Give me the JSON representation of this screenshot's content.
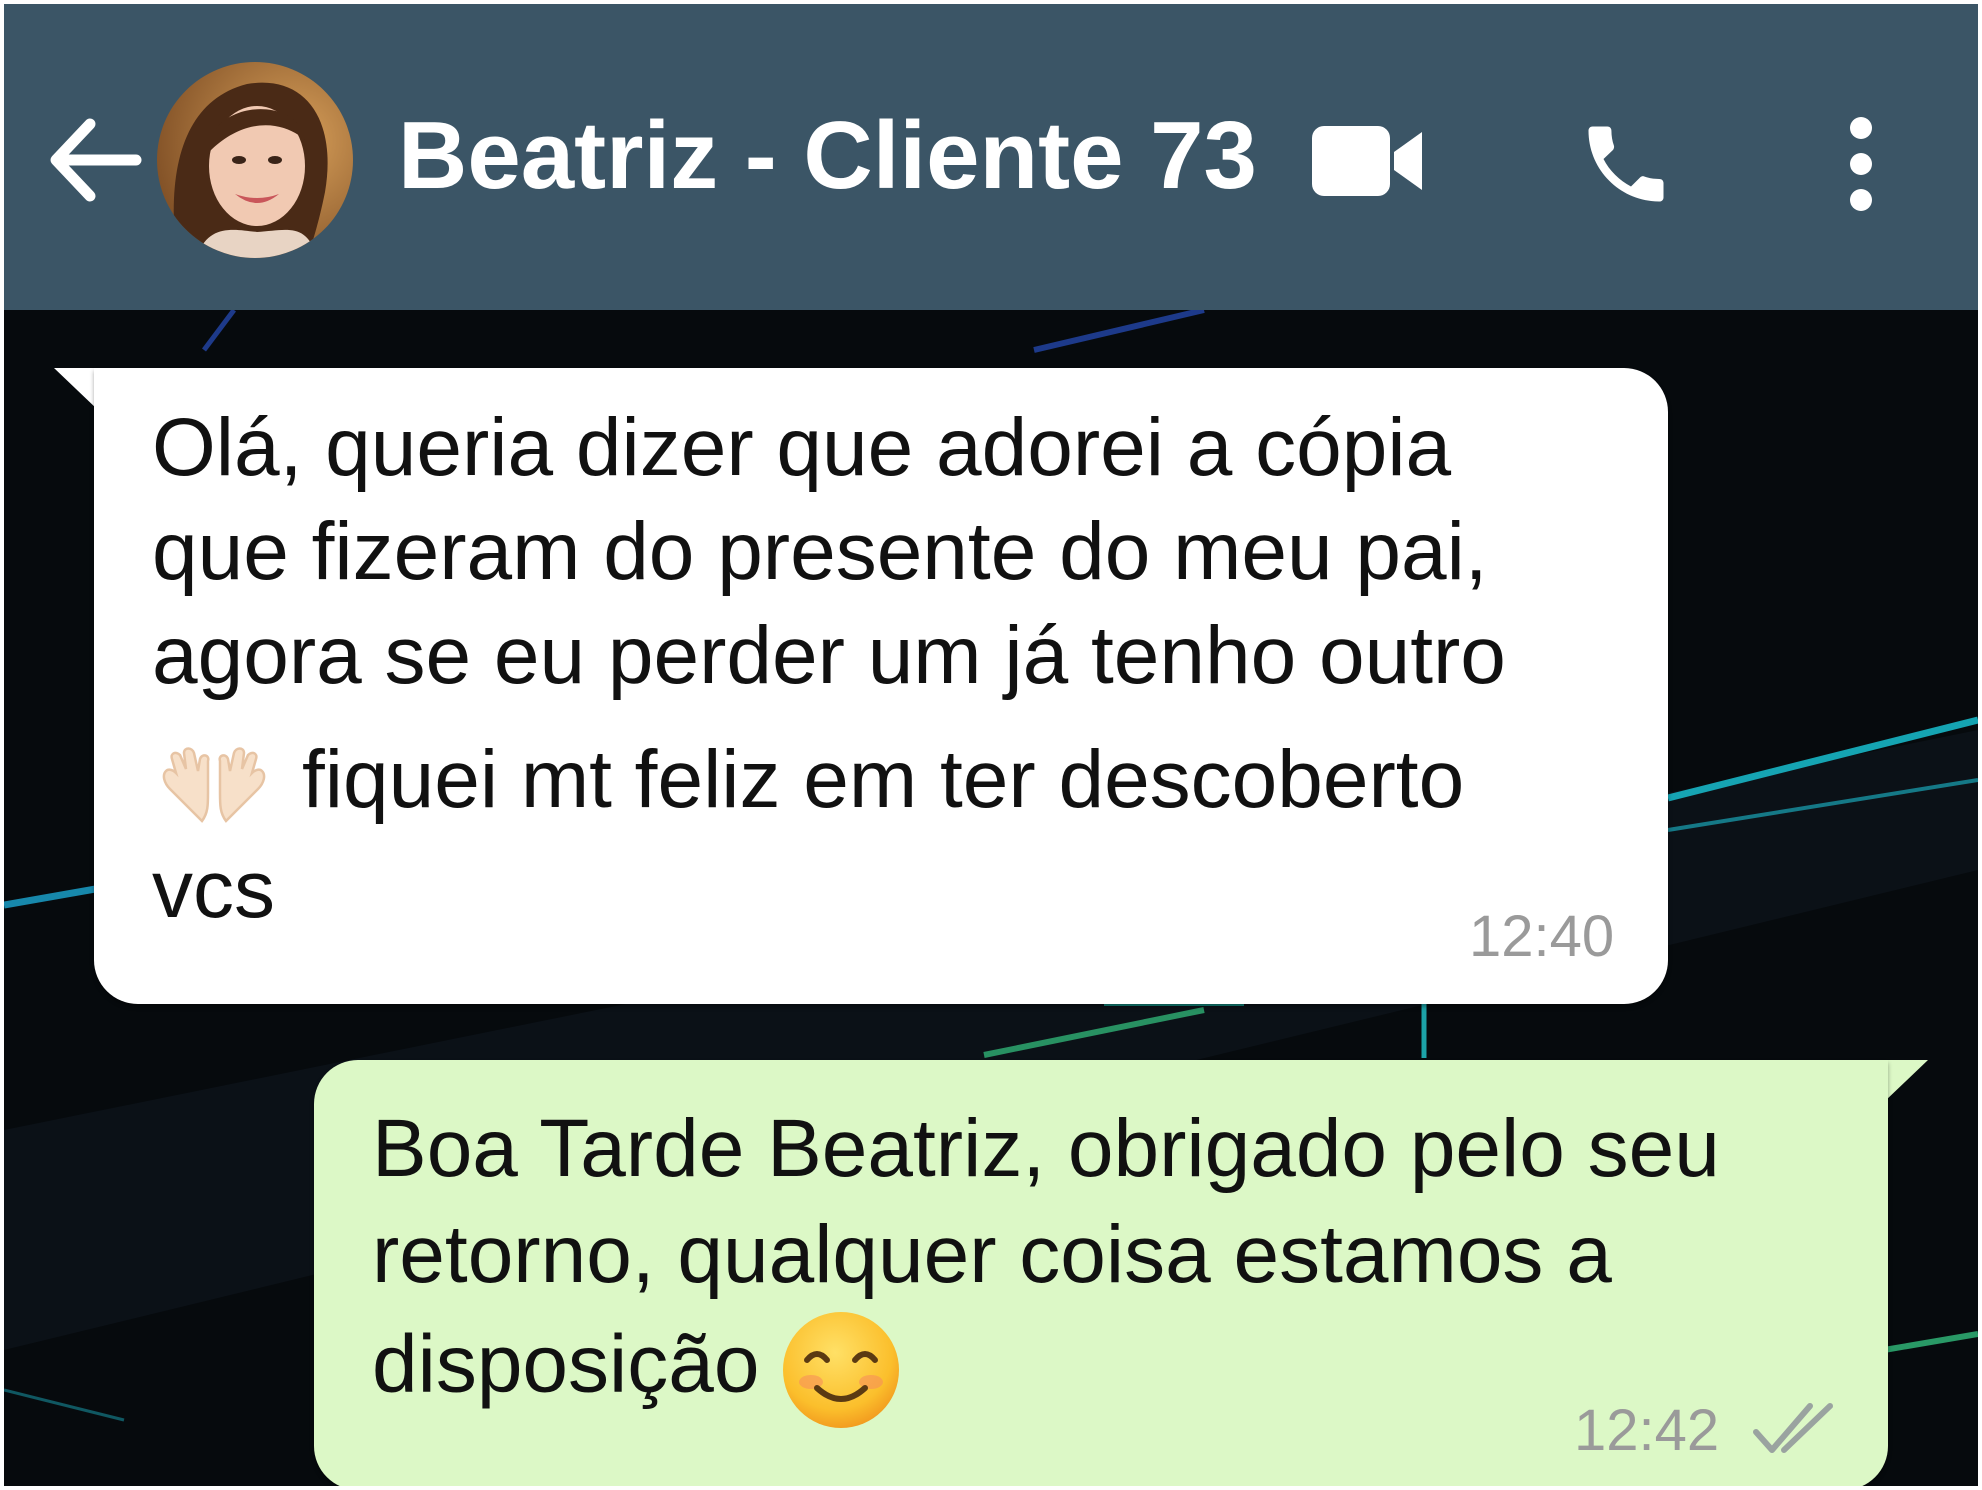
{
  "header": {
    "contact_name": "Beatriz - Cliente 73",
    "icons": [
      "back-arrow-icon",
      "avatar",
      "video-camera-icon",
      "phone-icon",
      "more-vertical-icon"
    ],
    "background_color": "#3b5566"
  },
  "messages": {
    "incoming": {
      "lines": [
        "Olá, queria dizer que adorei a cópia",
        "que fizeram do presente do meu pai,",
        "agora se eu perder um já tenho outro",
        "fiquei mt feliz em ter descoberto",
        "vcs"
      ],
      "emoji": "raising-hands-emoji",
      "time": "12:40"
    },
    "outgoing": {
      "lines": [
        "Boa Tarde Beatriz, obrigado pelo seu",
        "retorno, qualquer coisa estamos a",
        "disposição"
      ],
      "emoji": "smiling-face-emoji",
      "time": "12:42",
      "status": "read-double-check-icon"
    }
  },
  "colors": {
    "incoming_bubble": "#ffffff",
    "outgoing_bubble": "#dcf8c6",
    "chat_background": "#060a0d"
  }
}
